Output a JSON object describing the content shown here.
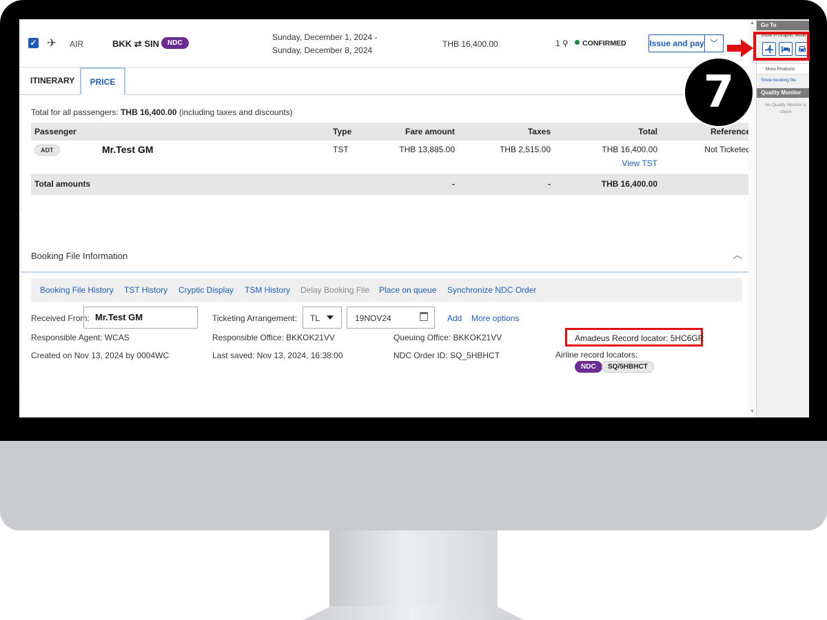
{
  "header": {
    "product": "AIR",
    "route_from": "BKK",
    "route_to": "SIN",
    "ndc_badge": "NDC",
    "date_line1": "Sunday, December 1, 2024  -",
    "date_line2": "Sunday, December 8, 2024",
    "price": "THB 16,400.00",
    "pax_count": "1",
    "status": "CONFIRMED",
    "status_color": "#1e8c3a",
    "issue_button": "Issue and pay"
  },
  "tabs": [
    {
      "label": "ITINERARY",
      "active": false
    },
    {
      "label": "PRICE",
      "active": true
    }
  ],
  "price": {
    "total_prefix": "Total for all passengers:",
    "total_value": "THB 16,400.00",
    "total_suffix": "(including taxes and discounts)",
    "columns": [
      "Passenger",
      "Type",
      "Fare amount",
      "Taxes",
      "Total",
      "Reference"
    ],
    "rows": [
      {
        "pax_type": "ADT",
        "name": "Mr.Test GM",
        "type": "TST",
        "fare": "THB 13,885.00",
        "taxes": "THB 2,515.00",
        "total": "THB 16,400.00",
        "view_link": "View TST",
        "reference": "Not Ticketed"
      }
    ],
    "totals": {
      "label": "Total amounts",
      "fare": "-",
      "taxes": "-",
      "total": "THB 16,400.00"
    }
  },
  "booking_file": {
    "title": "Booking File Information",
    "links": [
      {
        "label": "Booking File History",
        "disabled": false
      },
      {
        "label": "TST History",
        "disabled": false
      },
      {
        "label": "Cryptic Display",
        "disabled": false
      },
      {
        "label": "TSM History",
        "disabled": false
      },
      {
        "label": "Delay Booking File",
        "disabled": true
      },
      {
        "label": "Place on queue",
        "disabled": false
      },
      {
        "label": "Synchronize NDC Order",
        "disabled": false
      }
    ],
    "received_from_label": "Received From:",
    "received_from_value": "Mr.Test GM",
    "ticketing_label": "Ticketing Arrangement:",
    "ticketing_type": "TL",
    "ticketing_date": "19NOV24",
    "add_link": "Add",
    "more_options": "More options",
    "responsible_agent": "Responsible Agent: WCAS",
    "responsible_office": "Responsible Office: BKKOK21VV",
    "queuing_office": "Queuing Office: BKKOK21VV",
    "amadeus_locator": "Amadeus Record locator: 5HC6GR",
    "created_on": "Created on Nov 13, 2024 by 0004WC",
    "last_saved": "Last saved: Nov 13, 2024, 16:38:00",
    "ndc_order_id": "NDC Order ID: SQ_5HBHCT",
    "airline_locators_label": "Airline record locators:",
    "airline_locator_badge": "NDC",
    "airline_locator_value": "SQ/5HBHCT"
  },
  "sidebar": {
    "goto": "Go To",
    "graphic_mode": "Show in Graphic Mode",
    "more_products": "More Products",
    "show_booking_file": "Show booking file",
    "quality_monitor": "Quality Monitor",
    "qm_text": "No Quality Monitor is check",
    "icons": [
      "flight-icon",
      "hotel-icon",
      "car-icon"
    ]
  },
  "annotation": {
    "step_number": "7",
    "highlight_color": "#e01010"
  }
}
